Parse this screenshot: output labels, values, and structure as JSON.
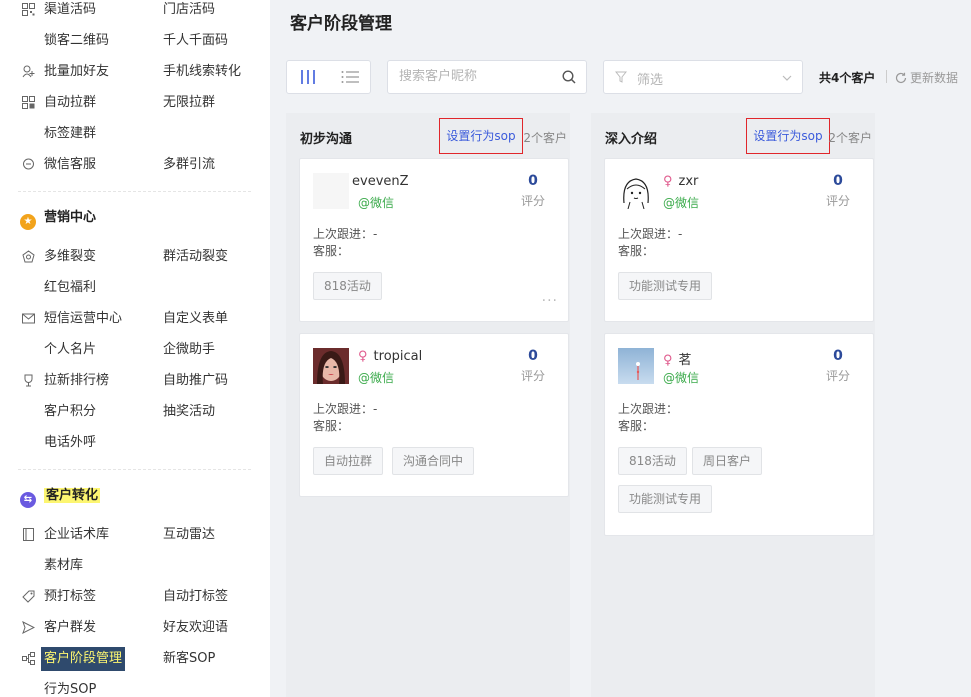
{
  "sidebar": {
    "rows": [
      {
        "left": "渠道活码",
        "right": "门店活码",
        "left_icon": "qrcode-icon"
      },
      {
        "left": "锁客二维码",
        "right": "千人千面码"
      },
      {
        "left": "批量加好友",
        "right": "手机线索转化",
        "left_icon": "add-friend-icon"
      },
      {
        "left": "自动拉群",
        "right": "无限拉群",
        "left_icon": "group-icon"
      },
      {
        "left": "标签建群"
      },
      {
        "left": "微信客服",
        "right": "多群引流",
        "left_icon": "chat-icon"
      }
    ],
    "marketing_title": "营销中心",
    "marketing_rows": [
      {
        "left": "多维裂变",
        "right": "群活动裂变",
        "left_icon": "fission-icon"
      },
      {
        "left": "红包福利"
      },
      {
        "left": "短信运营中心",
        "right": "自定义表单",
        "left_icon": "mail-icon"
      },
      {
        "left": "个人名片",
        "right": "企微助手"
      },
      {
        "left": "拉新排行榜",
        "right": "自助推广码",
        "left_icon": "trophy-icon"
      },
      {
        "left": "客户积分",
        "right": "抽奖活动"
      },
      {
        "left": "电话外呼"
      }
    ],
    "conversion_title": "客户转化",
    "conversion_rows": [
      {
        "left": "企业话术库",
        "right": "互动雷达",
        "left_icon": "book-icon"
      },
      {
        "left": "素材库"
      },
      {
        "left": "预打标签",
        "right": "自动打标签",
        "left_icon": "tag-icon"
      },
      {
        "left": "客户群发",
        "right": "好友欢迎语",
        "left_icon": "send-icon"
      },
      {
        "left": "客户阶段管理",
        "right": "新客SOP",
        "left_icon": "stage-icon"
      },
      {
        "left": "行为SOP"
      }
    ]
  },
  "main": {
    "title": "客户阶段管理",
    "search_placeholder": "搜索客户昵称",
    "filter_placeholder": "筛选",
    "total_prefix": "共",
    "total_count": "4",
    "total_suffix": "个客户",
    "refresh_label": "更新数据"
  },
  "columns": [
    {
      "name": "初步沟通",
      "sop_label": "设置行为sop",
      "count_label": "2个客户",
      "cards": [
        {
          "name": "evevenZ",
          "source": "@微信",
          "score": "0",
          "score_label": "评分",
          "last_follow_label": "上次跟进：",
          "last_follow": "-",
          "agent_label": "客服：",
          "tags": [
            "818活动"
          ],
          "avatar": "blank"
        },
        {
          "name": "tropical",
          "source": "@微信",
          "score": "0",
          "score_label": "评分",
          "last_follow_label": "上次跟进：",
          "last_follow": "-",
          "agent_label": "客服：",
          "tags": [
            "自动拉群",
            "沟通合同中"
          ],
          "avatar": "photo-woman"
        }
      ]
    },
    {
      "name": "深入介绍",
      "sop_label": "设置行为sop",
      "count_label": "2个客户",
      "cards": [
        {
          "name": "zxr",
          "source": "@微信",
          "score": "0",
          "score_label": "评分",
          "last_follow_label": "上次跟进：",
          "last_follow": "-",
          "agent_label": "客服：",
          "tags": [
            "功能测试专用"
          ],
          "avatar": "sketch-girl"
        },
        {
          "name": "茗",
          "source": "@微信",
          "score": "0",
          "score_label": "评分",
          "last_follow_label": "上次跟进：",
          "last_follow": "",
          "agent_label": "客服：",
          "tags": [
            "818活动",
            "周日客户",
            "功能测试专用"
          ],
          "avatar": "sky-photo"
        }
      ]
    }
  ]
}
